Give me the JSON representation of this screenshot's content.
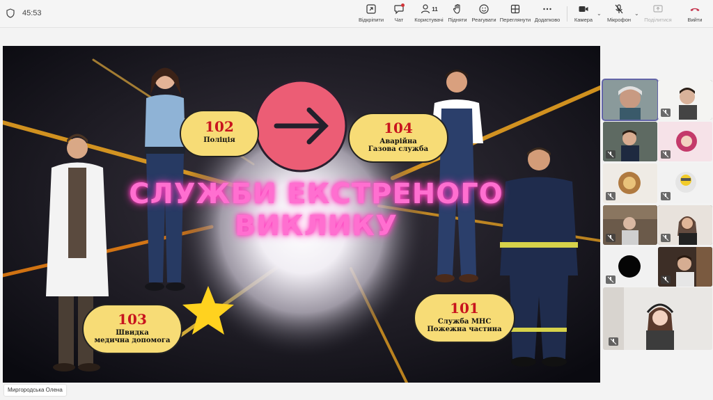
{
  "timer": "45:53",
  "toolbar": {
    "open_label": "Відкріпити",
    "chat_label": "Чат",
    "people_label": "Користувачі",
    "people_count": "11",
    "raise_label": "Підняти",
    "react_label": "Реагувати",
    "view_label": "Переглянути",
    "more_label": "Додатково",
    "camera_label": "Камера",
    "mic_label": "Мікрофон",
    "share_label": "Поділитися",
    "leave_label": "Вийти"
  },
  "slide": {
    "title_line1": "СЛУЖБИ ЕКСТРЕНОГО",
    "title_line2": "ВИКЛИКУ",
    "police_number": "102",
    "police_label": "Поліція",
    "gas_number": "104",
    "gas_label1": "Аварійна",
    "gas_label2": "Газова служба",
    "ambulance_number": "103",
    "ambulance_label1": "Швидка",
    "ambulance_label2": "медична допомога",
    "fire_number": "101",
    "fire_label1": "Служба МНС",
    "fire_label2": "Пожежна частина"
  },
  "presenter_name": "Миргородська Олена",
  "colors": {
    "accent": "#6264a7",
    "leave": "#c4314b",
    "bubble": "#f7dc76",
    "title_pink": "#ff5ec8",
    "arrow_circle": "#ec5d75"
  }
}
